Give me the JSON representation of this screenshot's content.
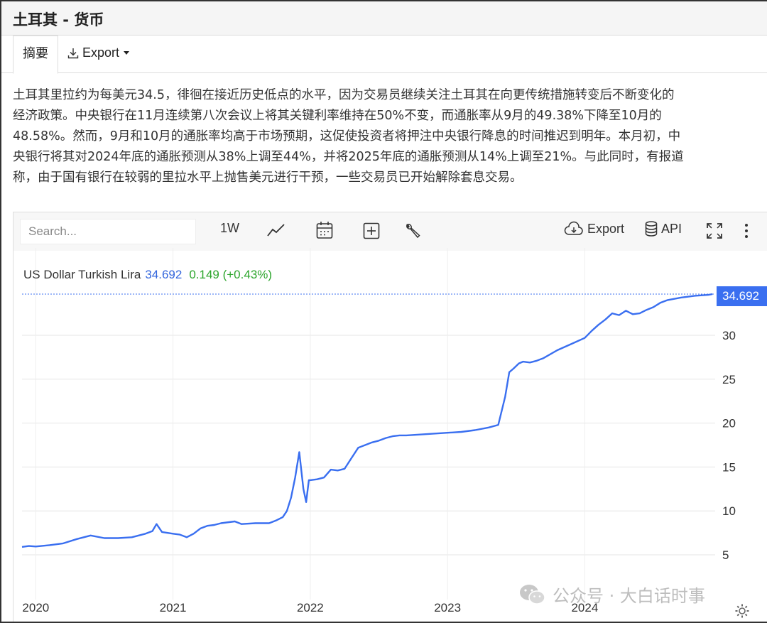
{
  "page": {
    "title": "土耳其 - 货币"
  },
  "tabs": {
    "summary": "摘要",
    "export": "Export"
  },
  "summary_lines": [
    "土耳其里拉约为每美元34.5，徘徊在接近历史低点的水平，因为交易员继续关注土耳其在向更传统措施转变后不断变化的",
    "经济政策。中央银行在11月连续第八次会议上将其关键利率维持在50%不变，而通胀率从9月的49.38%下降至10月的",
    "48.58%。然而，9月和10月的通胀率均高于市场预期，这促使投资者将押注中央银行降息的时间推迟到明年。本月初，中",
    "央银行将其对2024年底的通胀预测从38%上调至44%，并将2025年底的通胀预测从14%上调至21%。与此同时，有报道",
    "称，由于国有银行在较弱的里拉水平上抛售美元进行干预，一些交易员已开始解除套息交易。"
  ],
  "toolbar": {
    "search_placeholder": "Search...",
    "period": "1W",
    "export": "Export",
    "api": "API"
  },
  "legend": {
    "name": "US Dollar Turkish Lira",
    "value": "34.692",
    "change": "0.149 (+0.43%)"
  },
  "price_tag": "34.692",
  "watermark": "公众号 · 大白话时事",
  "colors": {
    "line": "#3a6ff0",
    "accent": "#3a6ff0",
    "positive": "#2ca52c"
  },
  "chart_data": {
    "type": "line",
    "title": "",
    "xlabel": "",
    "ylabel": "",
    "x_ticks": [
      "2020",
      "2021",
      "2022",
      "2023",
      "2024"
    ],
    "y_ticks": [
      5,
      10,
      15,
      20,
      25,
      30
    ],
    "ylim": [
      0,
      35
    ],
    "xlim": [
      2019.9,
      2024.95
    ],
    "grid": true,
    "last_value": 34.692,
    "series": [
      {
        "name": "US Dollar Turkish Lira",
        "x": [
          2019.9,
          2019.95,
          2020.0,
          2020.1,
          2020.2,
          2020.3,
          2020.35,
          2020.4,
          2020.5,
          2020.6,
          2020.7,
          2020.8,
          2020.85,
          2020.88,
          2020.92,
          2021.0,
          2021.05,
          2021.1,
          2021.15,
          2021.2,
          2021.25,
          2021.3,
          2021.35,
          2021.45,
          2021.5,
          2021.6,
          2021.7,
          2021.75,
          2021.8,
          2021.83,
          2021.86,
          2021.89,
          2021.92,
          2021.95,
          2021.97,
          2021.99,
          2022.0,
          2022.05,
          2022.1,
          2022.15,
          2022.2,
          2022.25,
          2022.3,
          2022.35,
          2022.4,
          2022.45,
          2022.5,
          2022.55,
          2022.6,
          2022.65,
          2022.7,
          2022.8,
          2022.9,
          2023.0,
          2023.1,
          2023.2,
          2023.3,
          2023.37,
          2023.42,
          2023.45,
          2023.48,
          2023.52,
          2023.55,
          2023.6,
          2023.65,
          2023.7,
          2023.8,
          2023.9,
          2024.0,
          2024.05,
          2024.1,
          2024.15,
          2024.2,
          2024.25,
          2024.3,
          2024.35,
          2024.4,
          2024.45,
          2024.5,
          2024.55,
          2024.6,
          2024.7,
          2024.8,
          2024.9,
          2024.93
        ],
        "values": [
          5.9,
          6.0,
          5.95,
          6.1,
          6.3,
          6.8,
          7.0,
          7.2,
          6.9,
          6.9,
          7.0,
          7.4,
          7.7,
          8.5,
          7.6,
          7.4,
          7.3,
          7.0,
          7.4,
          8.0,
          8.3,
          8.4,
          8.6,
          8.8,
          8.5,
          8.6,
          8.6,
          8.9,
          9.3,
          10.0,
          11.5,
          13.8,
          16.7,
          12.5,
          11.0,
          13.5,
          13.5,
          13.6,
          13.8,
          14.7,
          14.6,
          14.8,
          16.0,
          17.2,
          17.5,
          17.8,
          18.0,
          18.3,
          18.5,
          18.6,
          18.6,
          18.7,
          18.8,
          18.9,
          19.0,
          19.2,
          19.5,
          19.8,
          23.0,
          25.8,
          26.2,
          26.8,
          27.0,
          26.9,
          27.1,
          27.4,
          28.3,
          29.0,
          29.7,
          30.5,
          31.2,
          31.8,
          32.5,
          32.3,
          32.8,
          32.4,
          32.5,
          32.9,
          33.2,
          33.7,
          34.0,
          34.3,
          34.5,
          34.6,
          34.69
        ]
      }
    ]
  }
}
